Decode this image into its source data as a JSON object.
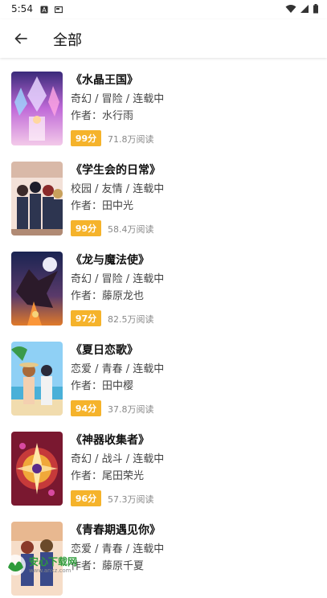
{
  "status_bar": {
    "time": "5:54"
  },
  "app_bar": {
    "title": "全部"
  },
  "books": [
    {
      "title": "《水晶王国》",
      "tags": "奇幻 / 冒险 / 连载中",
      "author": "作者：水行雨",
      "score": "99分",
      "reads": "71.8万阅读",
      "cover_icon": "crystal-kingdom-cover"
    },
    {
      "title": "《学生会的日常》",
      "tags": "校园 / 友情 / 连载中",
      "author": "作者：田中光",
      "score": "99分",
      "reads": "58.4万阅读",
      "cover_icon": "student-council-cover"
    },
    {
      "title": "《龙与魔法使》",
      "tags": "奇幻 / 冒险 / 连载中",
      "author": "作者：藤原龙也",
      "score": "97分",
      "reads": "82.5万阅读",
      "cover_icon": "dragon-mage-cover"
    },
    {
      "title": "《夏日恋歌》",
      "tags": "恋爱 / 青春 / 连载中",
      "author": "作者：田中樱",
      "score": "94分",
      "reads": "37.8万阅读",
      "cover_icon": "summer-love-cover"
    },
    {
      "title": "《神器收集者》",
      "tags": "奇幻 / 战斗 / 连载中",
      "author": "作者：尾田荣光",
      "score": "96分",
      "reads": "57.3万阅读",
      "cover_icon": "artifact-collector-cover"
    },
    {
      "title": "《青春期遇见你》",
      "tags": "恋爱 / 青春 / 连载中",
      "author": "作者：藤原千夏",
      "score": "",
      "reads": "",
      "cover_icon": "adolescence-cover"
    }
  ],
  "watermark": {
    "text": "安心下载网",
    "sub": "www.anxz.com"
  },
  "colors": {
    "score_badge": "#f5b32b",
    "accent_watermark": "#2e9b3a"
  }
}
